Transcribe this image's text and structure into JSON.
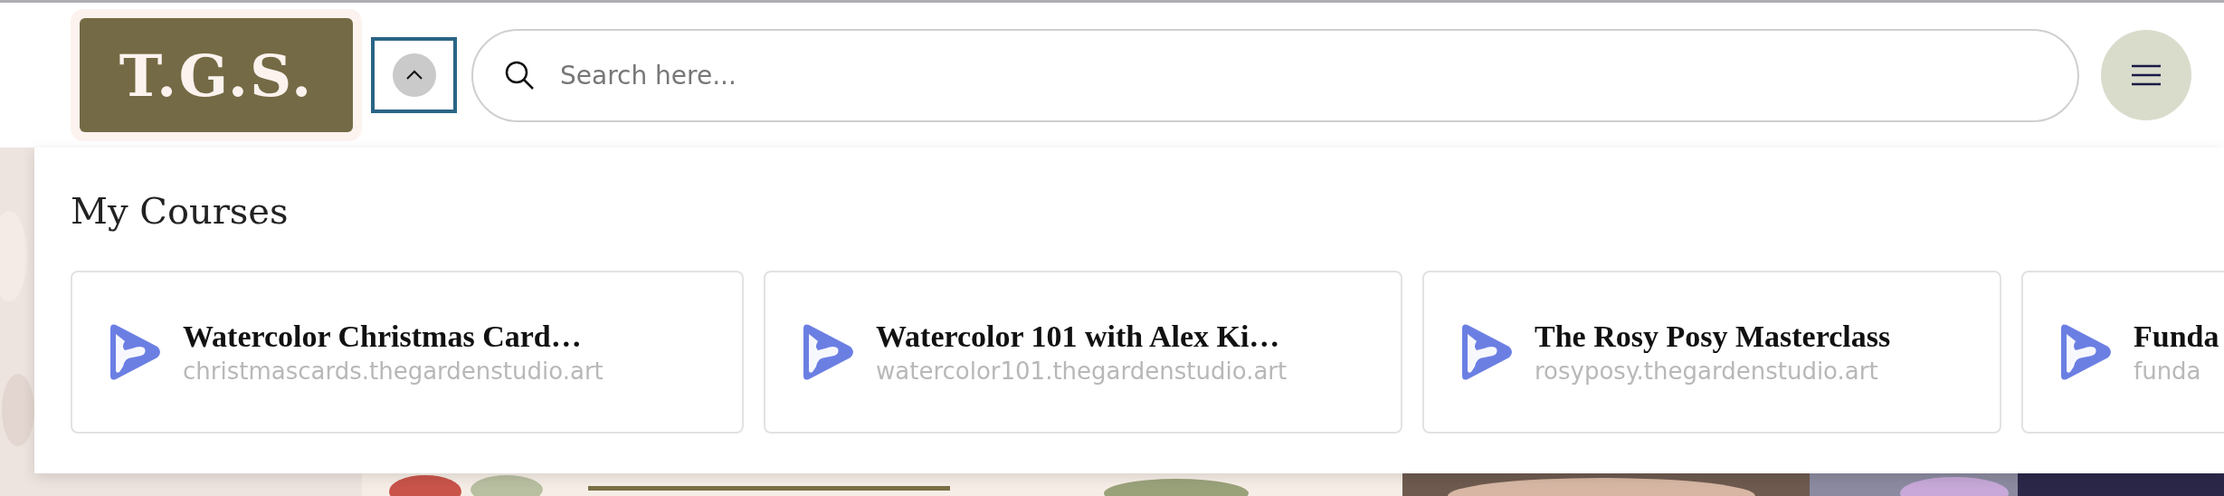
{
  "header": {
    "logo": "T.G.S.",
    "collapse_button": {
      "expanded": true
    },
    "search": {
      "placeholder": "Search here..."
    }
  },
  "courses_menu": {
    "title": "My Courses",
    "courses": [
      {
        "title": "Watercolor Christmas Card…",
        "url": "christmascards.thegardenstudio.art"
      },
      {
        "title": "Watercolor 101 with Alex Ki…",
        "url": "watercolor101.thegardenstudio.art"
      },
      {
        "title": "The Rosy Posy Masterclass",
        "url": "rosyposy.thegardenstudio.art"
      },
      {
        "title": "Funda",
        "url": "funda"
      }
    ]
  }
}
